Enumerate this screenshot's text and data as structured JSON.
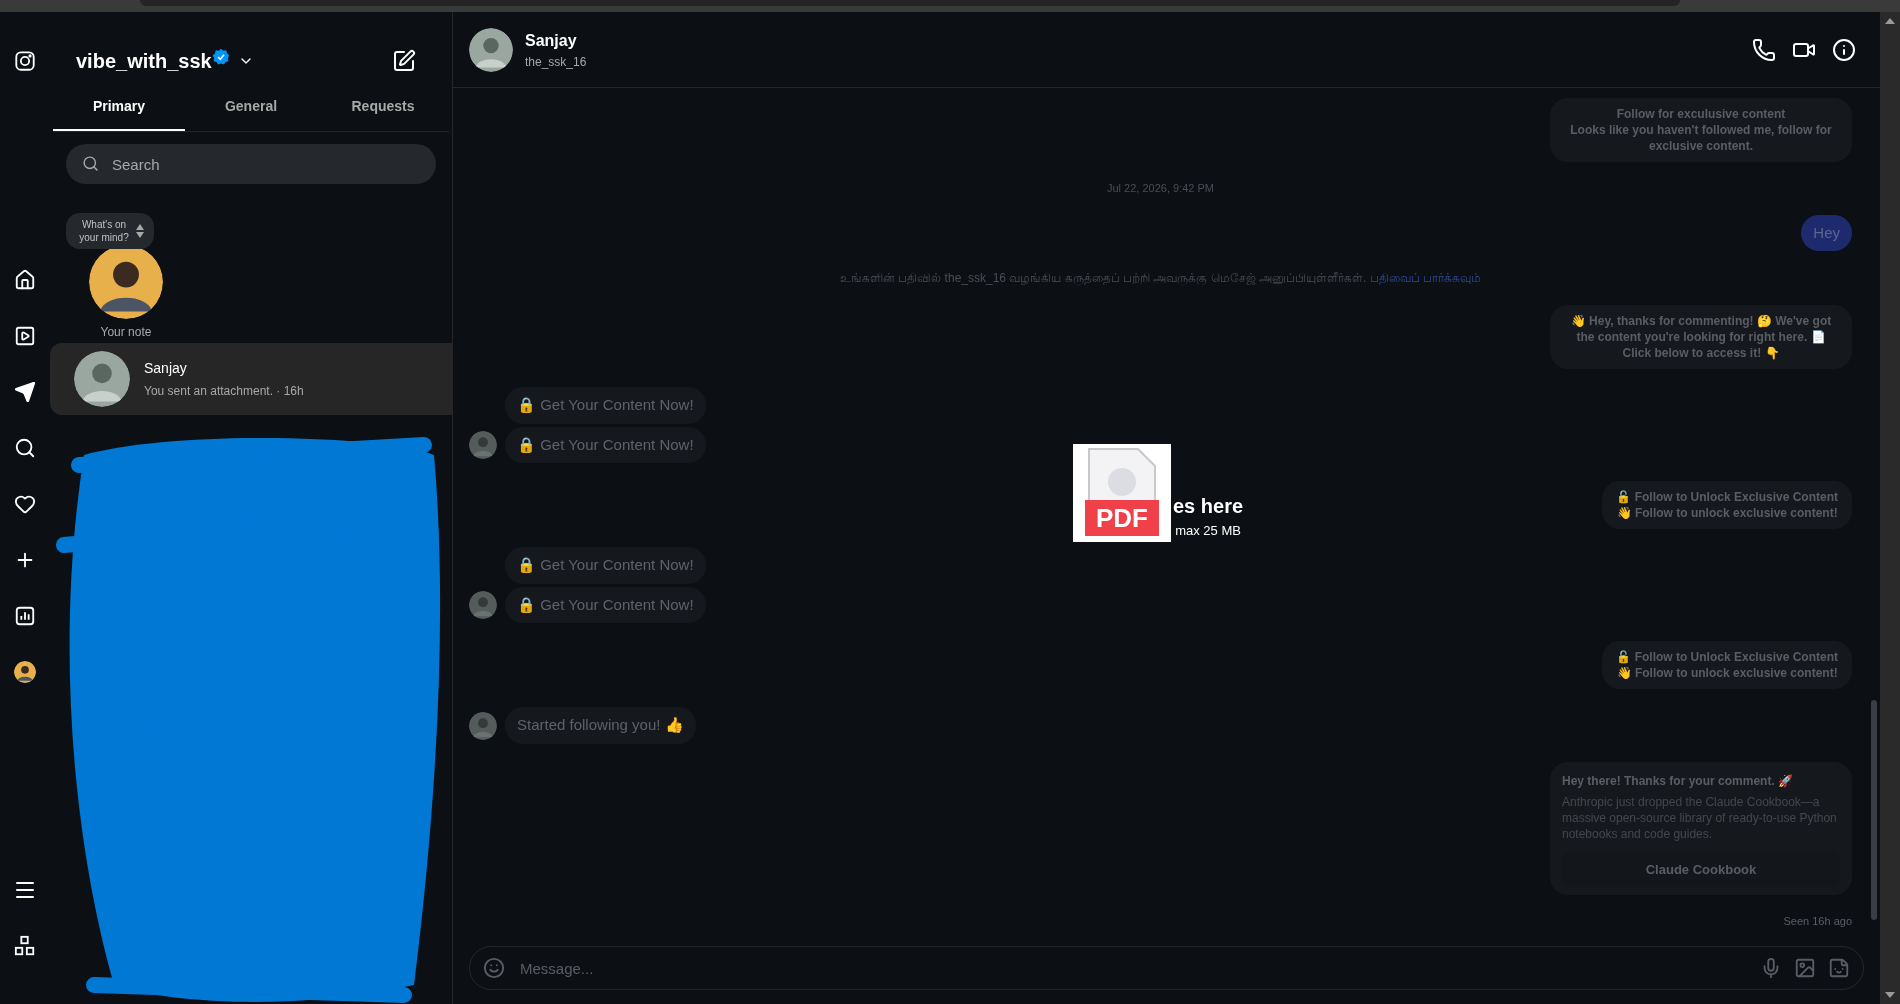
{
  "account": {
    "username": "vibe_with_ssk",
    "verified": true
  },
  "tabs": [
    {
      "label": "Primary",
      "selected": true
    },
    {
      "label": "General",
      "selected": false
    },
    {
      "label": "Requests",
      "selected": false
    }
  ],
  "search": {
    "placeholder": "Search"
  },
  "note": {
    "prompt": "What's on your mind?",
    "label": "Your note"
  },
  "conversations": [
    {
      "name": "Sanjay",
      "preview": "You sent an attachment. · 16h",
      "selected": true
    }
  ],
  "chat": {
    "name": "Sanjay",
    "handle": "the_ssk_16"
  },
  "messages": [
    {
      "kind": "card",
      "lines": [
        "Follow for exculusive content",
        "Looks like you haven't followed me, follow for exclusive content."
      ]
    },
    {
      "kind": "timestamp",
      "text": "Jul 22, 2026, 9:42 PM"
    },
    {
      "kind": "bubble",
      "text": "Hey"
    },
    {
      "kind": "notice",
      "text": "உங்களின் பதிவில் the_ssk_16 வழங்கிய கருத்தைப் பற்றி அவருக்கு மெசேஜ் அனுப்பியுள்ளீர்கள்.",
      "link": "பதிவைப் பார்க்கவும்"
    },
    {
      "kind": "card",
      "lines": [
        "👋 Hey, thanks for commenting! 🤔 We've got the content you're looking for right here. 📄 Click below to access it! 👇"
      ]
    },
    {
      "kind": "group",
      "texts": [
        "🔒 Get Your Content Now!",
        "🔒 Get Your Content Now!"
      ]
    },
    {
      "kind": "card",
      "lines": [
        "🔓 Follow to Unlock Exclusive Content",
        "👋 Follow to unlock exclusive content!"
      ]
    },
    {
      "kind": "group",
      "texts": [
        "🔒 Get Your Content Now!",
        "🔒 Get Your Content Now!"
      ]
    },
    {
      "kind": "card",
      "lines": [
        "🔓 Follow to Unlock Exclusive Content",
        "👋 Follow to unlock exclusive content!"
      ]
    },
    {
      "kind": "group",
      "texts": [
        "Started following you! 👍"
      ]
    },
    {
      "kind": "promo",
      "title": "Hey there! Thanks for your comment. 🚀",
      "body": "Anthropic just dropped the Claude Cookbook—a massive open-source library of ready-to-use Python notebooks and code guides.",
      "button": "Claude Cookbook"
    },
    {
      "kind": "status",
      "text": "Seen 16h ago"
    }
  ],
  "drop_overlay": {
    "file_type": "PDF",
    "title": "es here",
    "limit": "max 25 MB"
  },
  "composer": {
    "placeholder": "Message..."
  }
}
